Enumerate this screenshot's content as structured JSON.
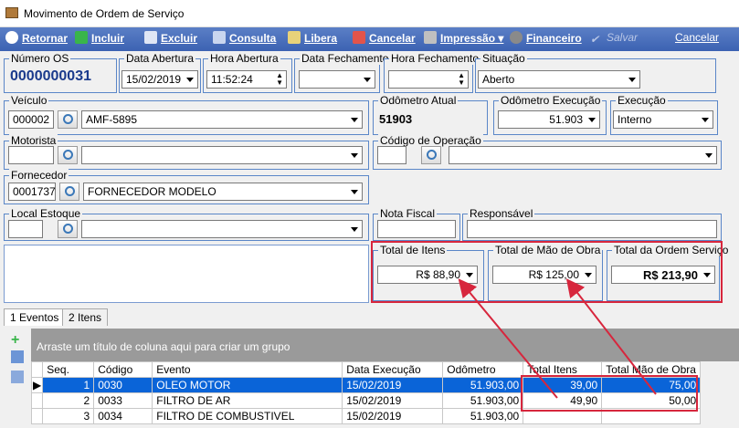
{
  "window": {
    "title": "Movimento de Ordem de Serviço"
  },
  "toolbar": {
    "retornar": "Retornar",
    "incluir": "Incluir",
    "excluir": "Excluir",
    "consulta": "Consulta",
    "libera": "Libera",
    "cancelar": "Cancelar",
    "impressao": "Impressão",
    "financeiro": "Financeiro",
    "salvar": "Salvar",
    "cancelar2": "Cancelar"
  },
  "header": {
    "numero_os_label": "Número OS",
    "numero_os": "0000000031",
    "data_abertura_label": "Data Abertura",
    "data_abertura": "15/02/2019",
    "hora_abertura_label": "Hora Abertura",
    "hora_abertura": "11:52:24",
    "data_fechamento_label": "Data Fechamento",
    "data_fechamento": "",
    "hora_fechamento_label": "Hora Fechamento",
    "hora_fechamento": "",
    "situacao_label": "Situação",
    "situacao": "Aberto"
  },
  "veiculo": {
    "label": "Veículo",
    "codigo": "000002",
    "nome": "AMF-5895"
  },
  "odometro_atual": {
    "label": "Odômetro Atual",
    "value": "51903"
  },
  "odometro_execucao": {
    "label": "Odômetro Execução",
    "value": "51.903"
  },
  "execucao": {
    "label": "Execução",
    "value": "Interno"
  },
  "motorista": {
    "label": "Motorista",
    "codigo": "",
    "nome": ""
  },
  "codigo_operacao": {
    "label": "Código de Operação",
    "codigo": "",
    "nome": ""
  },
  "fornecedor": {
    "label": "Fornecedor",
    "codigo": "0001737",
    "nome": "FORNECEDOR MODELO"
  },
  "local_estoque": {
    "label": "Local Estoque",
    "codigo": "",
    "nome": ""
  },
  "nota_fiscal": {
    "label": "Nota Fiscal",
    "value": ""
  },
  "responsavel": {
    "label": "Responsável",
    "value": ""
  },
  "totais": {
    "itens_label": "Total de Itens",
    "itens": "R$ 88,90",
    "mao_obra_label": "Total de Mão de Obra",
    "mao_obra": "R$ 125,00",
    "ordem_label": "Total da Ordem Serviço",
    "ordem": "R$ 213,90"
  },
  "tabs": [
    {
      "label": "1 Eventos"
    },
    {
      "label": "2 Itens"
    }
  ],
  "grid": {
    "group_hint": "Arraste um título de coluna aqui para criar um grupo",
    "columns": [
      "Seq.",
      "Código",
      "Evento",
      "Data Execução",
      "Odômetro",
      "Total Itens",
      "Total Mão de Obra"
    ],
    "rows": [
      {
        "seq": "1",
        "codigo": "0030",
        "evento": "OLEO MOTOR",
        "data": "15/02/2019",
        "odometro": "51.903,00",
        "itens": "39,00",
        "mao": "75,00"
      },
      {
        "seq": "2",
        "codigo": "0033",
        "evento": "FILTRO DE AR",
        "data": "15/02/2019",
        "odometro": "51.903,00",
        "itens": "49,90",
        "mao": "50,00"
      },
      {
        "seq": "3",
        "codigo": "0034",
        "evento": "FILTRO DE COMBUSTIVEL",
        "data": "15/02/2019",
        "odometro": "51.903,00",
        "itens": "",
        "mao": ""
      }
    ]
  },
  "colors": {
    "toolbar": "#3c62b2",
    "group_border": "#5a86c8",
    "highlight": "#d7263d",
    "selected_row": "#0a64d8"
  }
}
